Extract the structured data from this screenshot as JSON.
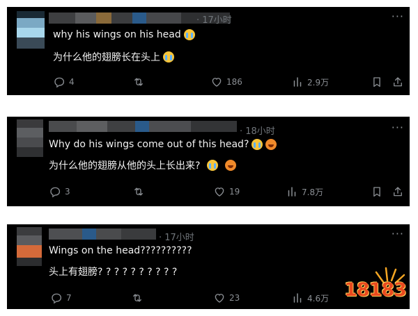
{
  "posts": [
    {
      "time": "· 17小时",
      "line_en": "why his wings on his head",
      "line_zh": "为什么他的翅膀长在头上",
      "stats": {
        "replies": "4",
        "likes": "186",
        "views": "2.9万"
      }
    },
    {
      "time": "· 18小时",
      "line_en": "Why do his wings come out of this head?",
      "line_zh": "为什么他的翅膀从他的头上长出来?",
      "stats": {
        "replies": "3",
        "likes": "19",
        "views": "7.8万"
      }
    },
    {
      "time": "· 17小时",
      "line_en": "Wings on the head??????????",
      "line_zh": "头上有翅膀? ? ? ? ? ? ? ? ? ?",
      "stats": {
        "replies": "7",
        "likes": "23",
        "views": "4.6万"
      }
    }
  ],
  "icons": {
    "reply": "reply-icon",
    "repost": "repost-icon",
    "like": "heart-icon",
    "views": "views-icon",
    "bookmark": "bookmark-icon",
    "share": "share-icon",
    "more": "more-icon"
  },
  "watermark": {
    "text": "18183"
  },
  "colors": {
    "background": "#000000",
    "text": "#e7e9ea",
    "muted": "#71767b",
    "watermark": "#e94a1f"
  }
}
